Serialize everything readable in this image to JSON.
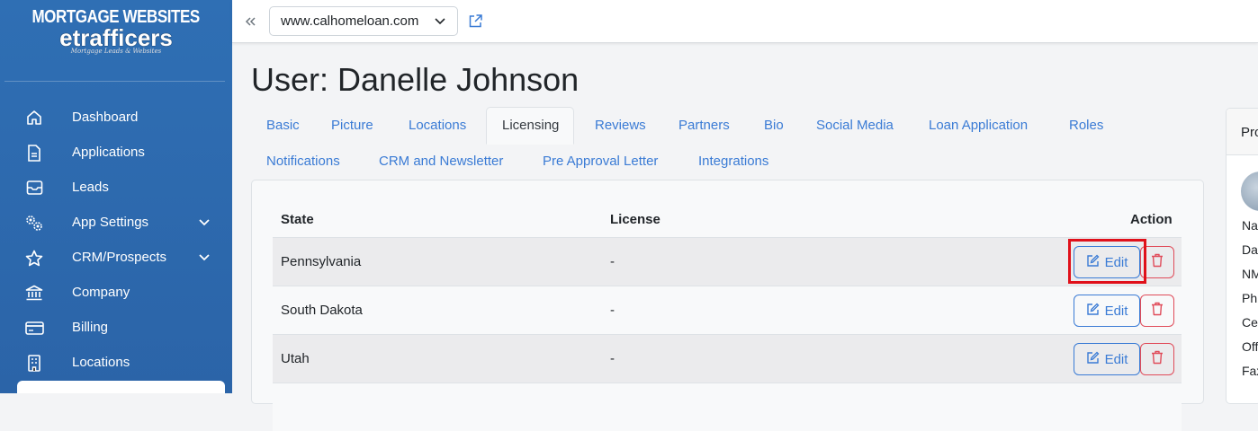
{
  "sidebar": {
    "logo_top": "MORTGAGE WEBSITES",
    "logo_brand": "etrafficers",
    "logo_tag": "Mortgage Leads & Websites",
    "items": [
      {
        "label": "Dashboard",
        "icon": "home-icon"
      },
      {
        "label": "Applications",
        "icon": "document-icon"
      },
      {
        "label": "Leads",
        "icon": "inbox-icon"
      },
      {
        "label": "App Settings",
        "icon": "gears-icon",
        "has_chevron": true
      },
      {
        "label": "CRM/Prospects",
        "icon": "star-icon",
        "has_chevron": true
      },
      {
        "label": "Company",
        "icon": "bank-icon"
      },
      {
        "label": "Billing",
        "icon": "credit-card-icon"
      },
      {
        "label": "Locations",
        "icon": "building-icon"
      }
    ]
  },
  "topbar": {
    "site_value": "www.calhomeloan.com"
  },
  "page": {
    "title": "User: Danelle Johnson"
  },
  "tabs": {
    "row1": [
      "Basic",
      "Picture",
      "Locations",
      "Licensing",
      "Reviews",
      "Partners",
      "Bio",
      "Social Media",
      "Loan Application",
      "Roles"
    ],
    "row2": [
      "Notifications",
      "CRM and Newsletter",
      "Pre Approval Letter",
      "Integrations"
    ],
    "active": "Licensing"
  },
  "table": {
    "headers": {
      "state": "State",
      "license": "License",
      "action": "Action"
    },
    "rows": [
      {
        "state": "Pennsylvania",
        "license": "-",
        "edit_label": "Edit"
      },
      {
        "state": "South Dakota",
        "license": "-",
        "edit_label": "Edit"
      },
      {
        "state": "Utah",
        "license": "-",
        "edit_label": "Edit"
      }
    ]
  },
  "right_card": {
    "header": "Pro",
    "lines": [
      "Na",
      "Da",
      "NM",
      "Ph",
      "Ce",
      "Off",
      "Fax"
    ]
  },
  "colors": {
    "sidebar": "#2f6fb4",
    "link": "#3a7bd5",
    "danger": "#e04b59",
    "highlight": "#e0101a"
  }
}
